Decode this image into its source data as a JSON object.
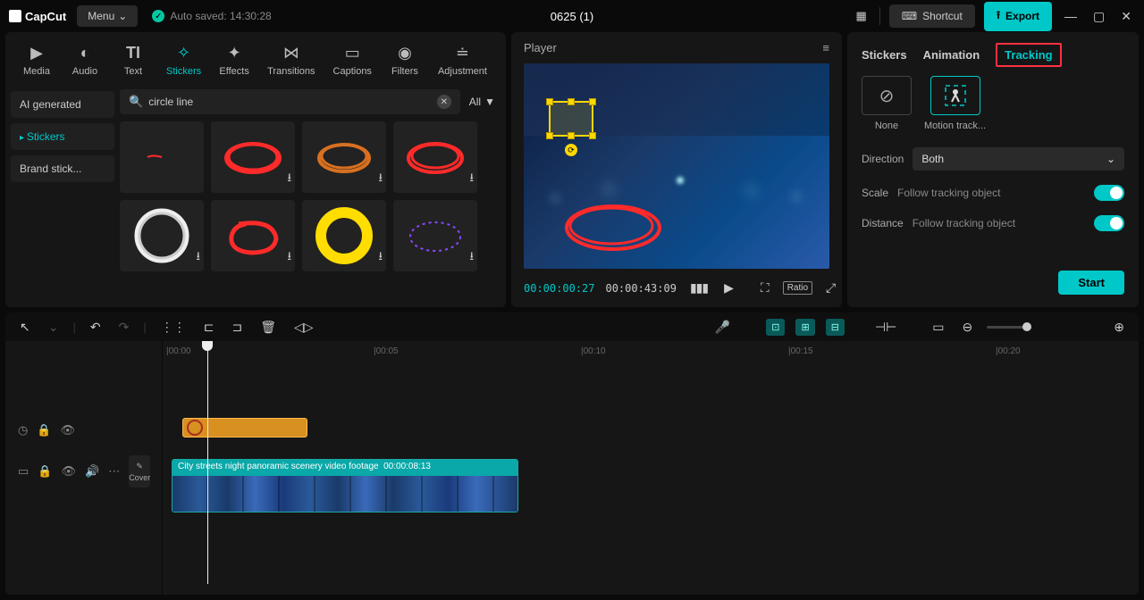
{
  "app": {
    "name": "CapCut",
    "menu": "Menu",
    "autosave": "Auto saved: 14:30:28",
    "project": "0625 (1)"
  },
  "topButtons": {
    "shortcut": "Shortcut",
    "export": "Export"
  },
  "tabs": {
    "media": "Media",
    "audio": "Audio",
    "text": "Text",
    "stickers": "Stickers",
    "effects": "Effects",
    "transitions": "Transitions",
    "captions": "Captions",
    "filters": "Filters",
    "adjustment": "Adjustment"
  },
  "sidebar": {
    "ai": "AI generated",
    "stickers": "Stickers",
    "brand": "Brand stick..."
  },
  "search": {
    "value": "circle line",
    "all": "All"
  },
  "player": {
    "title": "Player",
    "current": "00:00:00:27",
    "total": "00:00:43:09",
    "ratio": "Ratio"
  },
  "inspector": {
    "stickers": "Stickers",
    "animation": "Animation",
    "tracking": "Tracking",
    "none": "None",
    "motion": "Motion track...",
    "direction": "Direction",
    "directionVal": "Both",
    "scale": "Scale",
    "distance": "Distance",
    "follow": "Follow tracking object",
    "start": "Start"
  },
  "ruler": {
    "t0": "|00:00",
    "t1": "|00:05",
    "t2": "|00:10",
    "t3": "|00:15",
    "t4": "|00:20"
  },
  "clip": {
    "title": "City streets night panoramic scenery video footage",
    "dur": "00:00:08:13"
  },
  "cover": "Cover"
}
